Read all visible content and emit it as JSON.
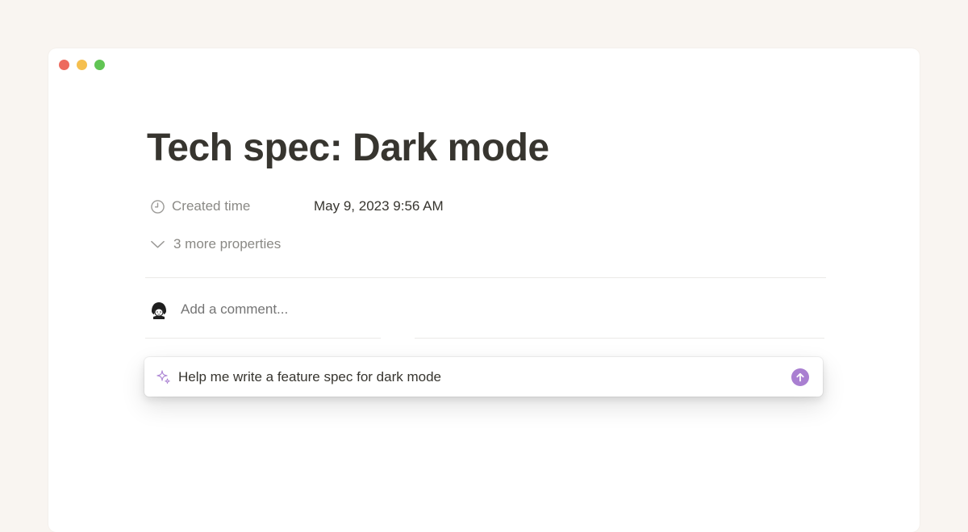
{
  "colors": {
    "background": "#f9f5f1",
    "window": "#ffffff",
    "traffic_close": "#ed6a5e",
    "traffic_minimize": "#f5bf4f",
    "traffic_zoom": "#61c554",
    "accent_purple": "#a97fd1",
    "muted_text": "#8a8985"
  },
  "window": {
    "traffic_lights": [
      "close-button",
      "minimize-button",
      "zoom-button"
    ]
  },
  "page": {
    "title": "Tech spec: Dark mode",
    "properties": [
      {
        "icon": "clock-icon",
        "name": "Created time",
        "value": "May 9, 2023 9:56 AM"
      }
    ],
    "more_properties": {
      "icon": "chevron-down-icon",
      "label": "3 more properties"
    },
    "comment": {
      "avatar": "avatar",
      "placeholder": "Add a comment..."
    },
    "ai_prompt": {
      "icon": "sparkle-icon",
      "value": "Help me write a feature spec for dark mode",
      "send_icon": "arrow-up-icon"
    }
  }
}
